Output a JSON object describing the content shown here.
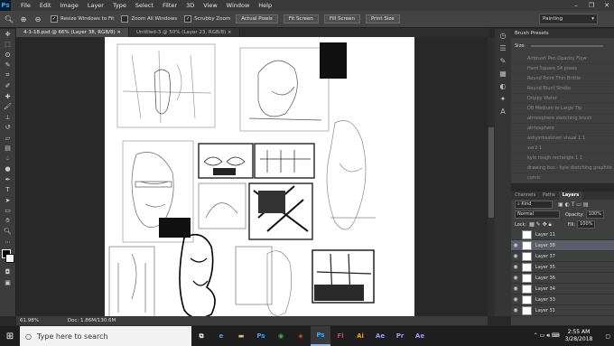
{
  "menu": [
    "File",
    "Edit",
    "Image",
    "Layer",
    "Type",
    "Select",
    "Filter",
    "3D",
    "View",
    "Window",
    "Help"
  ],
  "options": {
    "checkboxes": [
      {
        "label": "Resize Windows to Fit",
        "checked": true
      },
      {
        "label": "Zoom All Windows",
        "checked": false
      },
      {
        "label": "Scrubby Zoom",
        "checked": true
      }
    ],
    "buttons": [
      "Actual Pixels",
      "Fit Screen",
      "Fill Screen",
      "Print Size"
    ],
    "workspace": "Painting"
  },
  "tabs": [
    {
      "label": "4-1-18.psd @ 66% (Layer 38, RGB/8) ×",
      "active": true
    },
    {
      "label": "Untitled-3 @ 50% (Layer 23, RGB/8) ×",
      "active": false
    }
  ],
  "status": {
    "zoom": "61.98%",
    "doc": "Doc: 1.86M/130.6M"
  },
  "brush_presets": {
    "title": "Brush Presets",
    "size_label": "Size:",
    "items": [
      "Airbrush Pen Opacity Flow",
      "Hard Square 54 pixels",
      "Round Point Thin Brittle",
      "Round Blunt Stroke",
      "Drippy Water",
      "DB Medium to Large Tip",
      "atmosphere sketching brush",
      "atmosphere",
      "ashyxmastover visual 1 1",
      "ver2 1",
      "kyle rough rectangle 1 1",
      "drawing box - kyle sketching graphite",
      "comic"
    ]
  },
  "layers": {
    "tabs": [
      "Channels",
      "Paths",
      "Layers"
    ],
    "kind": "Kind",
    "blend": "Normal",
    "opacity_label": "Opacity:",
    "opacity": "100%",
    "lock_label": "Lock:",
    "fill_label": "Fill:",
    "fill": "100%",
    "rows": [
      {
        "name": "Layer 11",
        "selected": false
      },
      {
        "name": "Layer 38",
        "selected": true
      },
      {
        "name": "Layer 37",
        "selected": false
      },
      {
        "name": "Layer 35",
        "selected": false
      },
      {
        "name": "Layer 36",
        "selected": false
      },
      {
        "name": "Layer 34",
        "selected": false
      },
      {
        "name": "Layer 33",
        "selected": false
      },
      {
        "name": "Layer 31",
        "selected": false
      }
    ]
  },
  "taskbar": {
    "search_placeholder": "Type here to search",
    "time": "2:55 AM",
    "date": "3/28/2018",
    "apps": [
      {
        "label": "⧉",
        "color": "#ffffff",
        "active": false
      },
      {
        "label": "e",
        "color": "#3ca0ff",
        "active": false
      },
      {
        "label": "▬",
        "color": "#e8c35a",
        "active": false
      },
      {
        "label": "Ps",
        "color": "#31a8ff",
        "active": false
      },
      {
        "label": "◉",
        "color": "#4caf50",
        "active": false
      },
      {
        "label": "◈",
        "color": "#e05030",
        "active": false
      },
      {
        "label": "Ps",
        "color": "#31a8ff",
        "active": true
      },
      {
        "label": "Fl",
        "color": "#e04040",
        "active": false
      },
      {
        "label": "Ai",
        "color": "#ff9a00",
        "active": false
      },
      {
        "label": "Ae",
        "color": "#9999ff",
        "active": false
      },
      {
        "label": "Pr",
        "color": "#9999ff",
        "active": false
      },
      {
        "label": "Ae",
        "color": "#9999ff",
        "active": false
      }
    ]
  }
}
